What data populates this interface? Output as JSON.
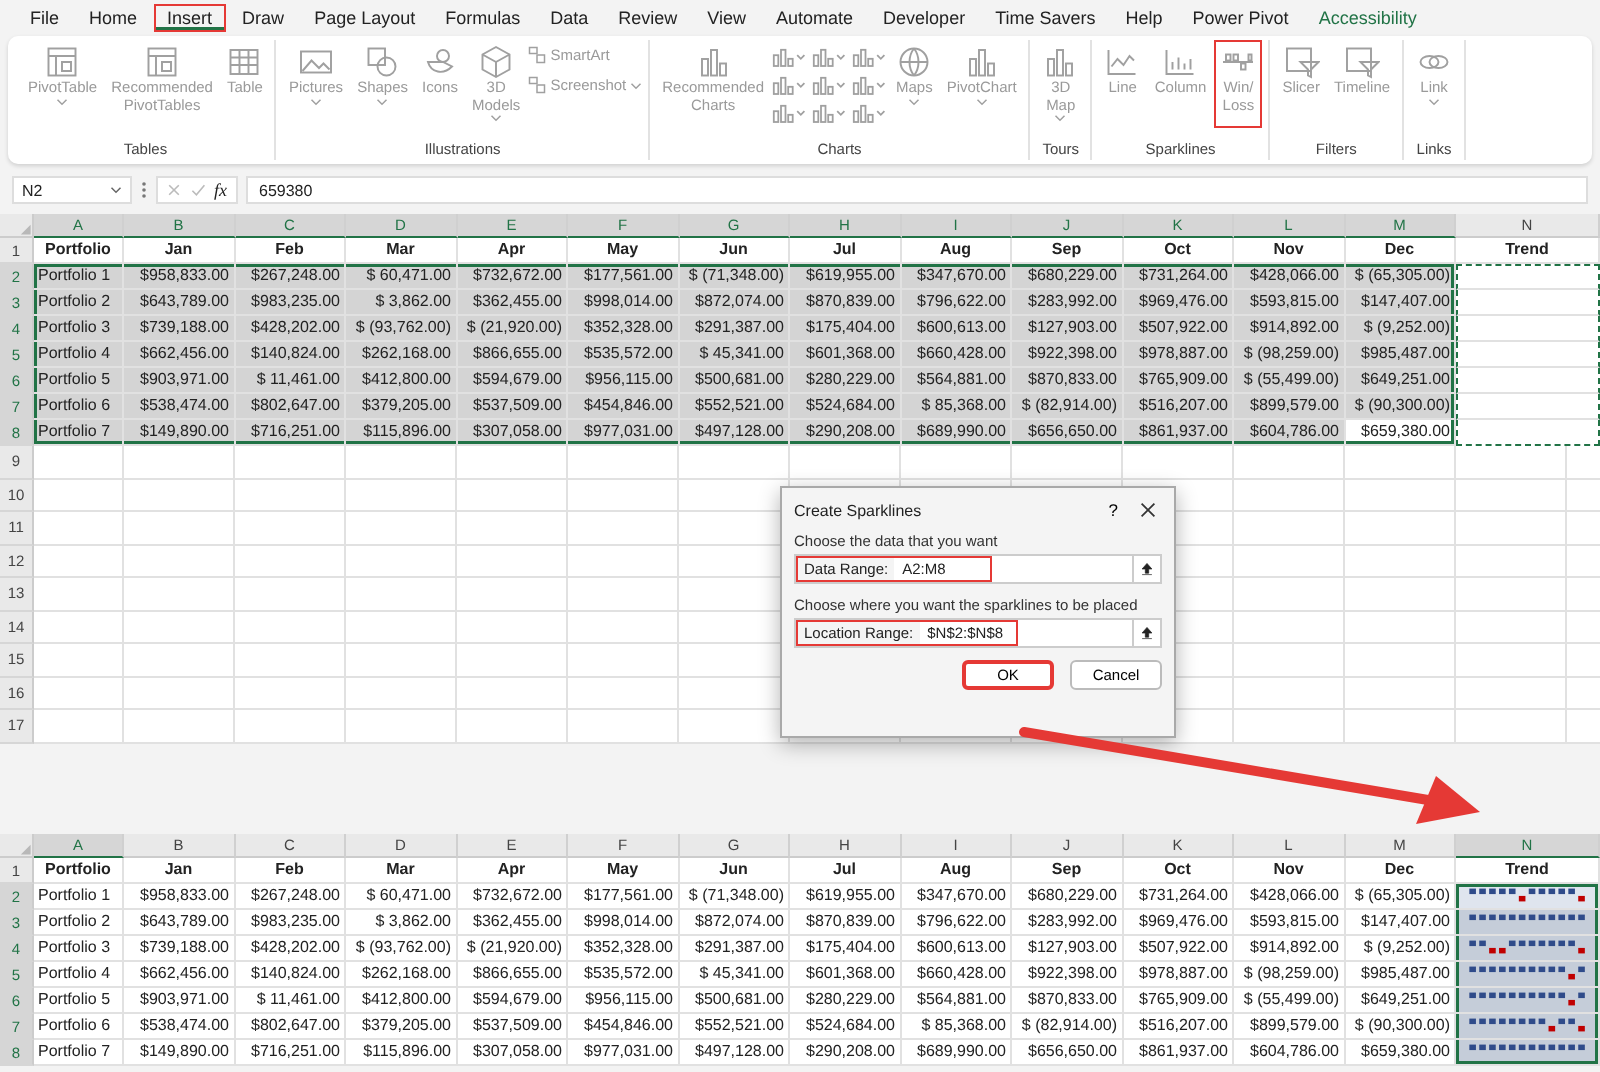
{
  "menu_tabs": [
    {
      "label": "File",
      "kind": "standard",
      "selected": false,
      "highlighted": false
    },
    {
      "label": "Home",
      "kind": "standard",
      "selected": false,
      "highlighted": false
    },
    {
      "label": "Insert",
      "kind": "standard",
      "selected": true,
      "highlighted": true
    },
    {
      "label": "Draw",
      "kind": "standard",
      "selected": false,
      "highlighted": false
    },
    {
      "label": "Page Layout",
      "kind": "standard",
      "selected": false,
      "highlighted": false
    },
    {
      "label": "Formulas",
      "kind": "standard",
      "selected": false,
      "highlighted": false
    },
    {
      "label": "Data",
      "kind": "standard",
      "selected": false,
      "highlighted": false
    },
    {
      "label": "Review",
      "kind": "standard",
      "selected": false,
      "highlighted": false
    },
    {
      "label": "View",
      "kind": "standard",
      "selected": false,
      "highlighted": false
    },
    {
      "label": "Automate",
      "kind": "standard",
      "selected": false,
      "highlighted": false
    },
    {
      "label": "Developer",
      "kind": "standard",
      "selected": false,
      "highlighted": false
    },
    {
      "label": "Time Savers",
      "kind": "standard",
      "selected": false,
      "highlighted": false
    },
    {
      "label": "Help",
      "kind": "standard",
      "selected": false,
      "highlighted": false
    },
    {
      "label": "Power Pivot",
      "kind": "standard",
      "selected": false,
      "highlighted": false
    },
    {
      "label": "Accessibility",
      "kind": "contextual",
      "selected": false,
      "highlighted": false
    }
  ],
  "ribbon": {
    "groups": [
      {
        "label": "Tables",
        "items": [
          {
            "kind": "large",
            "label": "PivotTable",
            "dropdown": true,
            "highlighted": false
          },
          {
            "kind": "large",
            "label": "Recommended\nPivotTables",
            "dropdown": false,
            "highlighted": false
          },
          {
            "kind": "large",
            "label": "Table",
            "dropdown": false,
            "highlighted": false
          }
        ]
      },
      {
        "label": "Illustrations",
        "items": [
          {
            "kind": "large",
            "label": "Pictures",
            "dropdown": true,
            "highlighted": false
          },
          {
            "kind": "large",
            "label": "Shapes",
            "dropdown": true,
            "highlighted": false
          },
          {
            "kind": "large",
            "label": "Icons",
            "dropdown": false,
            "highlighted": false
          },
          {
            "kind": "large",
            "label": "3D\nModels",
            "dropdown": true,
            "highlighted": false
          },
          {
            "kind": "stack",
            "entries": [
              {
                "label": "SmartArt",
                "dropdown": false
              },
              {
                "label": "Screenshot",
                "dropdown": true
              }
            ]
          }
        ]
      },
      {
        "label": "Charts",
        "items": [
          {
            "kind": "large",
            "label": "Recommended\nCharts",
            "dropdown": false,
            "highlighted": false
          },
          {
            "kind": "gallery"
          },
          {
            "kind": "large",
            "label": "Maps",
            "dropdown": true,
            "highlighted": false
          },
          {
            "kind": "large",
            "label": "PivotChart",
            "dropdown": true,
            "highlighted": false
          }
        ]
      },
      {
        "label": "Tours",
        "items": [
          {
            "kind": "large",
            "label": "3D\nMap",
            "dropdown": true,
            "highlighted": false
          }
        ]
      },
      {
        "label": "Sparklines",
        "items": [
          {
            "kind": "large",
            "label": "Line",
            "dropdown": false,
            "highlighted": false
          },
          {
            "kind": "large",
            "label": "Column",
            "dropdown": false,
            "highlighted": false
          },
          {
            "kind": "large",
            "label": "Win/\nLoss",
            "dropdown": false,
            "highlighted": true
          }
        ]
      },
      {
        "label": "Filters",
        "items": [
          {
            "kind": "large",
            "label": "Slicer",
            "dropdown": false,
            "highlighted": false
          },
          {
            "kind": "large",
            "label": "Timeline",
            "dropdown": false,
            "highlighted": false
          }
        ]
      },
      {
        "label": "Links",
        "items": [
          {
            "kind": "large",
            "label": "Link",
            "dropdown": true,
            "highlighted": false
          }
        ]
      }
    ]
  },
  "formula_bar": {
    "name_box": "N2",
    "function_label": "fx",
    "formula": "659380"
  },
  "top_sheet": {
    "data_selected": true,
    "trend_selected": false,
    "location_marquee": true,
    "columns": [
      {
        "label": "A",
        "selected": true
      },
      {
        "label": "B",
        "selected": true
      },
      {
        "label": "C",
        "selected": true
      },
      {
        "label": "D",
        "selected": true
      },
      {
        "label": "E",
        "selected": true
      },
      {
        "label": "F",
        "selected": true
      },
      {
        "label": "G",
        "selected": true
      },
      {
        "label": "H",
        "selected": true
      },
      {
        "label": "I",
        "selected": true
      },
      {
        "label": "J",
        "selected": true
      },
      {
        "label": "K",
        "selected": true
      },
      {
        "label": "L",
        "selected": true
      },
      {
        "label": "M",
        "selected": true
      },
      {
        "label": "N",
        "selected": false
      }
    ],
    "rows": [
      {
        "number": "1",
        "kind": "header",
        "selected": false,
        "sparkline": false,
        "cells": [
          "Portfolio",
          "Jan",
          "Feb",
          "Mar",
          "Apr",
          "May",
          "Jun",
          "Jul",
          "Aug",
          "Sep",
          "Oct",
          "Nov",
          "Dec",
          "Trend"
        ]
      },
      {
        "number": "2",
        "kind": "data",
        "selected": true,
        "sparkline": false,
        "cells": [
          "Portfolio 1",
          "$958,833.00",
          "$267,248.00",
          "$ 60,471.00",
          "$732,672.00",
          "$177,561.00",
          "$ (71,348.00)",
          "$619,955.00",
          "$347,670.00",
          "$680,229.00",
          "$731,264.00",
          "$428,066.00",
          "$ (65,305.00)"
        ]
      },
      {
        "number": "3",
        "kind": "data",
        "selected": true,
        "sparkline": false,
        "cells": [
          "Portfolio 2",
          "$643,789.00",
          "$983,235.00",
          "$ 3,862.00",
          "$362,455.00",
          "$998,014.00",
          "$872,074.00",
          "$870,839.00",
          "$796,622.00",
          "$283,992.00",
          "$969,476.00",
          "$593,815.00",
          "$147,407.00"
        ]
      },
      {
        "number": "4",
        "kind": "data",
        "selected": true,
        "sparkline": false,
        "cells": [
          "Portfolio 3",
          "$739,188.00",
          "$428,202.00",
          "$ (93,762.00)",
          "$ (21,920.00)",
          "$352,328.00",
          "$291,387.00",
          "$175,404.00",
          "$600,613.00",
          "$127,903.00",
          "$507,922.00",
          "$914,892.00",
          "$ (9,252.00)"
        ]
      },
      {
        "number": "5",
        "kind": "data",
        "selected": true,
        "sparkline": false,
        "cells": [
          "Portfolio 4",
          "$662,456.00",
          "$140,824.00",
          "$262,168.00",
          "$866,655.00",
          "$535,572.00",
          "$ 45,341.00",
          "$601,368.00",
          "$660,428.00",
          "$922,398.00",
          "$978,887.00",
          "$ (98,259.00)",
          "$985,487.00"
        ]
      },
      {
        "number": "6",
        "kind": "data",
        "selected": true,
        "sparkline": false,
        "cells": [
          "Portfolio 5",
          "$903,971.00",
          "$ 11,461.00",
          "$412,800.00",
          "$594,679.00",
          "$956,115.00",
          "$500,681.00",
          "$280,229.00",
          "$564,881.00",
          "$870,833.00",
          "$765,909.00",
          "$ (55,499.00)",
          "$649,251.00"
        ]
      },
      {
        "number": "7",
        "kind": "data",
        "selected": true,
        "sparkline": false,
        "cells": [
          "Portfolio 6",
          "$538,474.00",
          "$802,647.00",
          "$379,205.00",
          "$537,509.00",
          "$454,846.00",
          "$552,521.00",
          "$524,684.00",
          "$ 85,368.00",
          "$ (82,914.00)",
          "$516,207.00",
          "$899,579.00",
          "$ (90,300.00)"
        ]
      },
      {
        "number": "8",
        "kind": "data",
        "selected": true,
        "sparkline": false,
        "active": true,
        "cells": [
          "Portfolio 7",
          "$149,890.00",
          "$716,251.00",
          "$115,896.00",
          "$307,058.00",
          "$977,031.00",
          "$497,128.00",
          "$290,208.00",
          "$689,990.00",
          "$656,650.00",
          "$861,937.00",
          "$604,786.00",
          "$659,380.00"
        ]
      }
    ],
    "blank_rows": [
      "9",
      "10",
      "11",
      "12",
      "13",
      "14",
      "15",
      "16",
      "17"
    ]
  },
  "dialog": {
    "title": "Create Sparklines",
    "help": "?",
    "sections": [
      {
        "prompt": "Choose the data that you want",
        "field_label": "Data Range:",
        "value": "A2:M8",
        "highlighted": true
      },
      {
        "prompt": "Choose where you want the sparklines to be placed",
        "field_label": "Location Range:",
        "value": "$N$2:$N$8",
        "highlighted": true
      }
    ],
    "buttons": [
      {
        "label": "OK",
        "highlighted": true
      },
      {
        "label": "Cancel",
        "highlighted": false
      }
    ]
  },
  "bottom_sheet": {
    "data_selected": false,
    "trend_selected": true,
    "location_marquee": false,
    "columns": [
      {
        "label": "A",
        "selected": true
      },
      {
        "label": "B",
        "selected": false
      },
      {
        "label": "C",
        "selected": false
      },
      {
        "label": "D",
        "selected": false
      },
      {
        "label": "E",
        "selected": false
      },
      {
        "label": "F",
        "selected": false
      },
      {
        "label": "G",
        "selected": false
      },
      {
        "label": "H",
        "selected": false
      },
      {
        "label": "I",
        "selected": false
      },
      {
        "label": "J",
        "selected": false
      },
      {
        "label": "K",
        "selected": false
      },
      {
        "label": "L",
        "selected": false
      },
      {
        "label": "M",
        "selected": false
      },
      {
        "label": "N",
        "selected": true
      }
    ],
    "rows": [
      {
        "number": "1",
        "kind": "header",
        "selected": false,
        "sparkline": false,
        "cells": [
          "Portfolio",
          "Jan",
          "Feb",
          "Mar",
          "Apr",
          "May",
          "Jun",
          "Jul",
          "Aug",
          "Sep",
          "Oct",
          "Nov",
          "Dec",
          "Trend"
        ]
      },
      {
        "number": "2",
        "kind": "data",
        "selected": true,
        "sparkline": true,
        "active": true,
        "cells": [
          "Portfolio 1",
          "$958,833.00",
          "$267,248.00",
          "$ 60,471.00",
          "$732,672.00",
          "$177,561.00",
          "$ (71,348.00)",
          "$619,955.00",
          "$347,670.00",
          "$680,229.00",
          "$731,264.00",
          "$428,066.00",
          "$ (65,305.00)"
        ]
      },
      {
        "number": "3",
        "kind": "data",
        "selected": true,
        "sparkline": true,
        "cells": [
          "Portfolio 2",
          "$643,789.00",
          "$983,235.00",
          "$ 3,862.00",
          "$362,455.00",
          "$998,014.00",
          "$872,074.00",
          "$870,839.00",
          "$796,622.00",
          "$283,992.00",
          "$969,476.00",
          "$593,815.00",
          "$147,407.00"
        ]
      },
      {
        "number": "4",
        "kind": "data",
        "selected": true,
        "sparkline": true,
        "cells": [
          "Portfolio 3",
          "$739,188.00",
          "$428,202.00",
          "$ (93,762.00)",
          "$ (21,920.00)",
          "$352,328.00",
          "$291,387.00",
          "$175,404.00",
          "$600,613.00",
          "$127,903.00",
          "$507,922.00",
          "$914,892.00",
          "$ (9,252.00)"
        ]
      },
      {
        "number": "5",
        "kind": "data",
        "selected": true,
        "sparkline": true,
        "cells": [
          "Portfolio 4",
          "$662,456.00",
          "$140,824.00",
          "$262,168.00",
          "$866,655.00",
          "$535,572.00",
          "$ 45,341.00",
          "$601,368.00",
          "$660,428.00",
          "$922,398.00",
          "$978,887.00",
          "$ (98,259.00)",
          "$985,487.00"
        ]
      },
      {
        "number": "6",
        "kind": "data",
        "selected": true,
        "sparkline": true,
        "cells": [
          "Portfolio 5",
          "$903,971.00",
          "$ 11,461.00",
          "$412,800.00",
          "$594,679.00",
          "$956,115.00",
          "$500,681.00",
          "$280,229.00",
          "$564,881.00",
          "$870,833.00",
          "$765,909.00",
          "$ (55,499.00)",
          "$649,251.00"
        ]
      },
      {
        "number": "7",
        "kind": "data",
        "selected": true,
        "sparkline": true,
        "cells": [
          "Portfolio 6",
          "$538,474.00",
          "$802,647.00",
          "$379,205.00",
          "$537,509.00",
          "$454,846.00",
          "$552,521.00",
          "$524,684.00",
          "$ 85,368.00",
          "$ (82,914.00)",
          "$516,207.00",
          "$899,579.00",
          "$ (90,300.00)"
        ]
      },
      {
        "number": "8",
        "kind": "data",
        "selected": true,
        "sparkline": true,
        "cells": [
          "Portfolio 7",
          "$149,890.00",
          "$716,251.00",
          "$115,896.00",
          "$307,058.00",
          "$977,031.00",
          "$497,128.00",
          "$290,208.00",
          "$689,990.00",
          "$656,650.00",
          "$861,937.00",
          "$604,786.00",
          "$659,380.00"
        ]
      }
    ]
  }
}
